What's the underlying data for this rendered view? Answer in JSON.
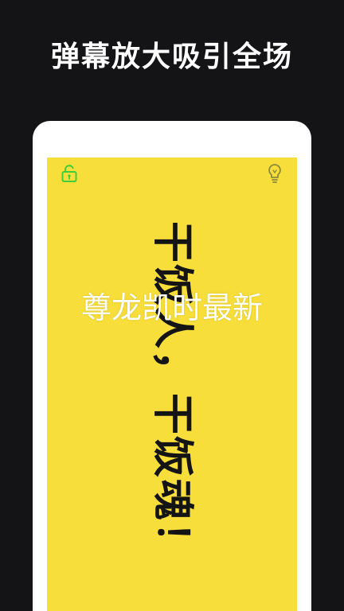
{
  "headline": "弹幕放大吸引全场",
  "marquee": {
    "text": "干饭人，干饭魂！",
    "background_color": "#f7de3b",
    "text_color": "#141414"
  },
  "watermark": "尊龙凯时最新",
  "icons": {
    "lock": "unlock-icon",
    "bulb": "lightbulb-icon"
  },
  "colors": {
    "page_background": "#141416",
    "lock_icon": "#3ccf3c",
    "bulb_icon": "#8a8a3a"
  }
}
